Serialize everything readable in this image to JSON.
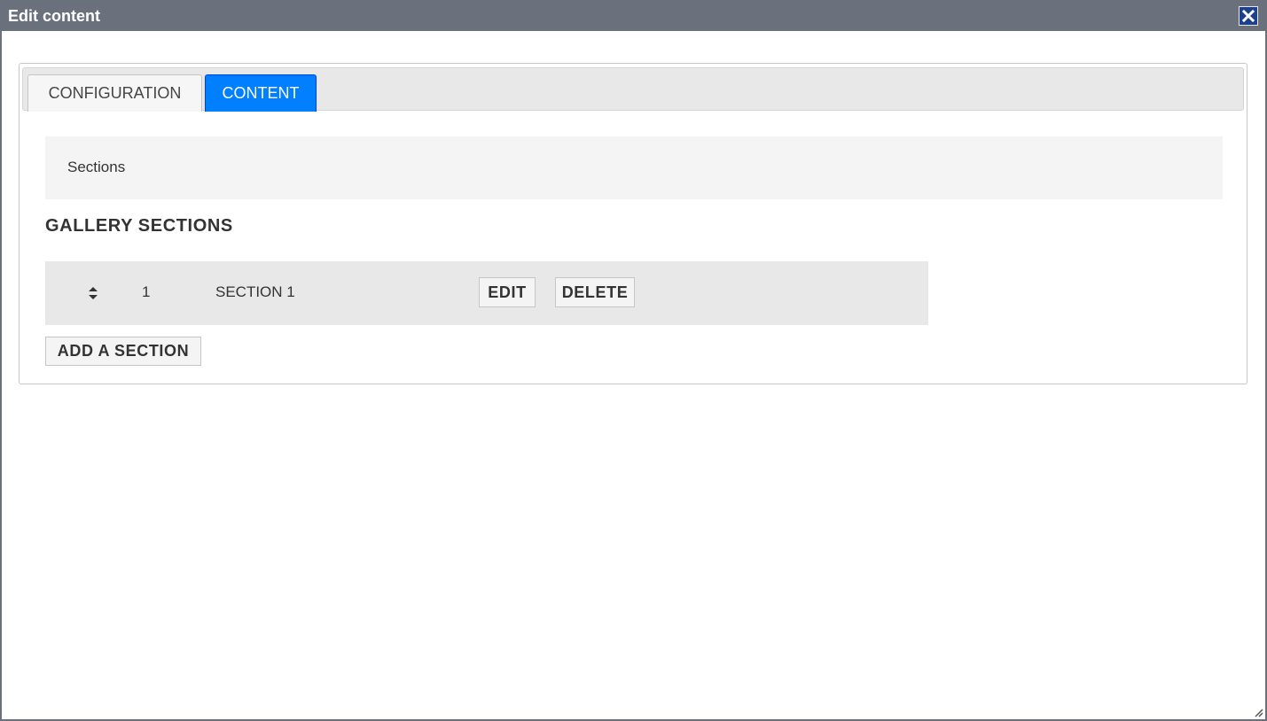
{
  "dialog": {
    "title": "Edit content",
    "close_icon": "close-icon"
  },
  "tabs": [
    {
      "label": "CONFIGURATION",
      "active": false
    },
    {
      "label": "CONTENT",
      "active": true
    }
  ],
  "colors": {
    "titlebar": "#6a717c",
    "active_tab": "#007fff",
    "close_button": "#1c3f8e"
  },
  "content": {
    "sections_label": "Sections",
    "gallery_heading": "GALLERY SECTIONS",
    "rows": [
      {
        "sort_icon": "sort-icon",
        "number": "1",
        "name": "SECTION 1",
        "edit_label": "EDIT",
        "delete_label": "DELETE"
      }
    ],
    "add_section_label": "ADD A SECTION"
  }
}
